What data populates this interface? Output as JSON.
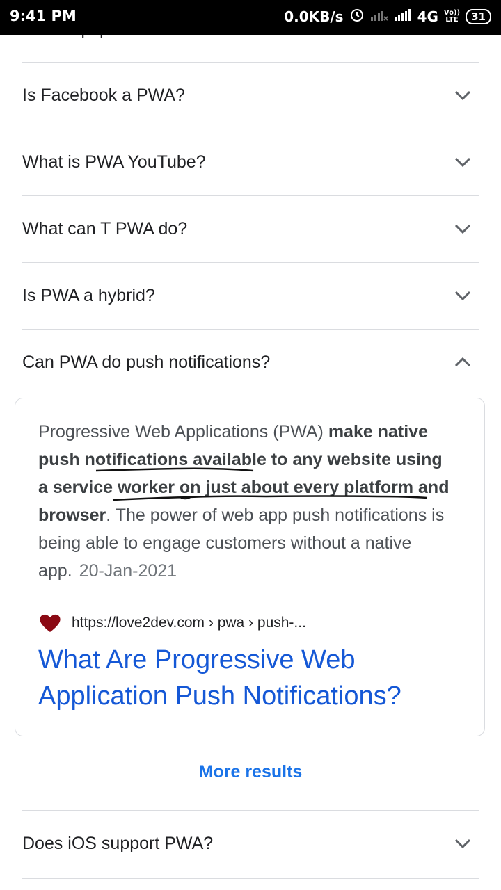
{
  "status_bar": {
    "time": "9:41 PM",
    "network_speed": "0.0KB/s",
    "network_type": "4G",
    "lte_label_top": "Vo))",
    "lte_label_bottom": "LTE",
    "battery": "31"
  },
  "partial_question": "Is PWA popular?",
  "questions": [
    {
      "label": "Is Facebook a PWA?"
    },
    {
      "label": "What is PWA YouTube?"
    },
    {
      "label": "What can T PWA do?"
    },
    {
      "label": "Is PWA a hybrid?"
    },
    {
      "label": "Can PWA do push notifications?"
    }
  ],
  "answer": {
    "intro": "Progressive Web Applications (PWA) ",
    "bold": "make native push notifications available to any website using a service worker on just about every platform and browser",
    "rest": ". The power of web app push notifications is being able to engage customers without a native app.",
    "date": "20-Jan-2021",
    "source_url": "https://love2dev.com › pwa › push-...",
    "title": "What Are Progressive Web Application Push Notifications?"
  },
  "more_results": "More results",
  "bottom_questions": [
    {
      "label": "Does iOS support PWA?"
    }
  ],
  "colors": {
    "link": "#1558d6",
    "more": "#1a73e8",
    "heart": "#8b0a14"
  }
}
